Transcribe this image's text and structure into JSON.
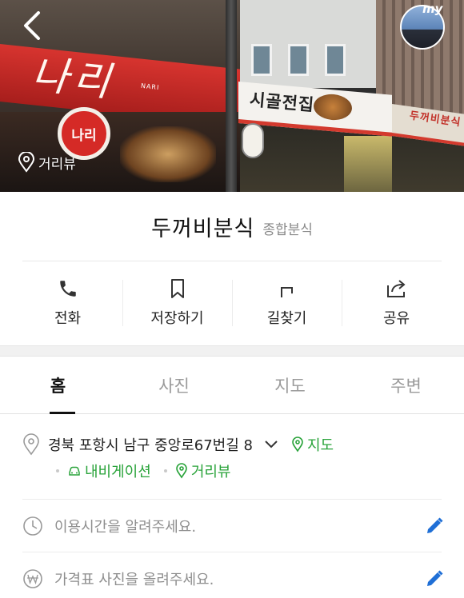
{
  "hero": {
    "roadview_label": "거리뷰",
    "my_label": "my",
    "signs": {
      "left_script": "나리",
      "left_script_sub": "NARI",
      "round_logo": "나리",
      "mid": "시골전집",
      "right": "두꺼비분식"
    }
  },
  "place": {
    "name": "두꺼비분식",
    "category": "종합분식"
  },
  "actions": [
    {
      "label": "전화",
      "icon": "phone-icon"
    },
    {
      "label": "저장하기",
      "icon": "bookmark-icon"
    },
    {
      "label": "길찾기",
      "icon": "directions-icon"
    },
    {
      "label": "공유",
      "icon": "share-icon"
    }
  ],
  "tabs": [
    {
      "label": "홈",
      "active": true
    },
    {
      "label": "사진",
      "active": false
    },
    {
      "label": "지도",
      "active": false
    },
    {
      "label": "주변",
      "active": false
    }
  ],
  "address": {
    "text": "경북 포항시 남구 중앙로67번길 8",
    "map_link": "지도",
    "navigation_link": "내비게이션",
    "roadview_link": "거리뷰"
  },
  "hours": {
    "placeholder": "이용시간을 알려주세요."
  },
  "price": {
    "placeholder": "가격표 사진을 올려주세요."
  },
  "colors": {
    "accent_green": "#29a33a",
    "edit_blue": "#1f6fd6",
    "tab_active": "#111111"
  }
}
